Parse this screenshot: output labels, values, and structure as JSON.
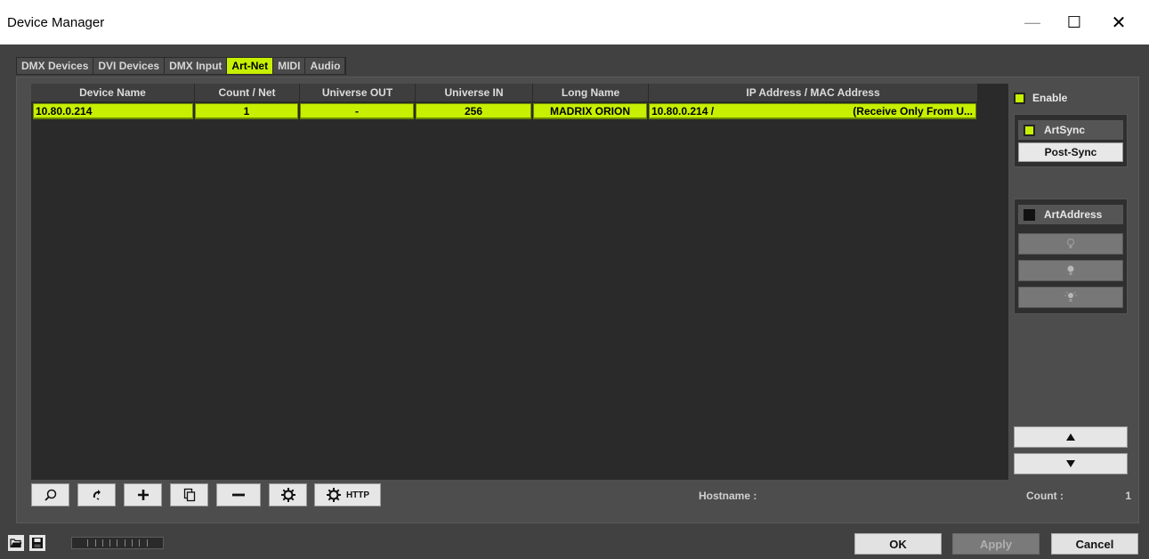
{
  "window": {
    "title": "Device Manager",
    "minimize": "—",
    "maximize": "☐",
    "close": "✕"
  },
  "tabs": [
    {
      "label": "DMX Devices",
      "active": false
    },
    {
      "label": "DVI Devices",
      "active": false
    },
    {
      "label": "DMX Input",
      "active": false
    },
    {
      "label": "Art-Net",
      "active": true
    },
    {
      "label": "MIDI",
      "active": false
    },
    {
      "label": "Audio",
      "active": false
    }
  ],
  "table": {
    "columns": [
      "Device Name",
      "Count / Net",
      "Universe OUT",
      "Universe IN",
      "Long Name",
      "IP Address / MAC Address"
    ],
    "rows": [
      {
        "device_name": "10.80.0.214",
        "count_net": "1",
        "universe_out": "-",
        "universe_in": "256",
        "long_name": "MADRIX ORION",
        "ip": "10.80.0.214 /",
        "mac_note": "(Receive Only From U..."
      }
    ]
  },
  "right": {
    "enable_label": "Enable",
    "enable_checked": true,
    "artsync_label": "ArtSync",
    "artsync_checked": true,
    "postsync_label": "Post-Sync",
    "artaddress_label": "ArtAddress",
    "artaddress_checked": false,
    "lamp_icons": [
      "lamp-off-icon",
      "lamp-on-icon",
      "lamp-flash-icon"
    ]
  },
  "toolbar": {
    "icons": [
      "search-icon",
      "refresh-icon",
      "plus-icon",
      "copy-icon",
      "minus-icon",
      "settings-icon",
      "http-settings-icon"
    ],
    "http_label": "HTTP",
    "hostname_label": "Hostname :",
    "count_label": "Count :",
    "count_value": "1"
  },
  "footer": {
    "ok_label": "OK",
    "apply_label": "Apply",
    "cancel_label": "Cancel"
  },
  "colors": {
    "accent": "#c6f000",
    "background": "#414141",
    "table_bg": "#2a2a2a"
  }
}
